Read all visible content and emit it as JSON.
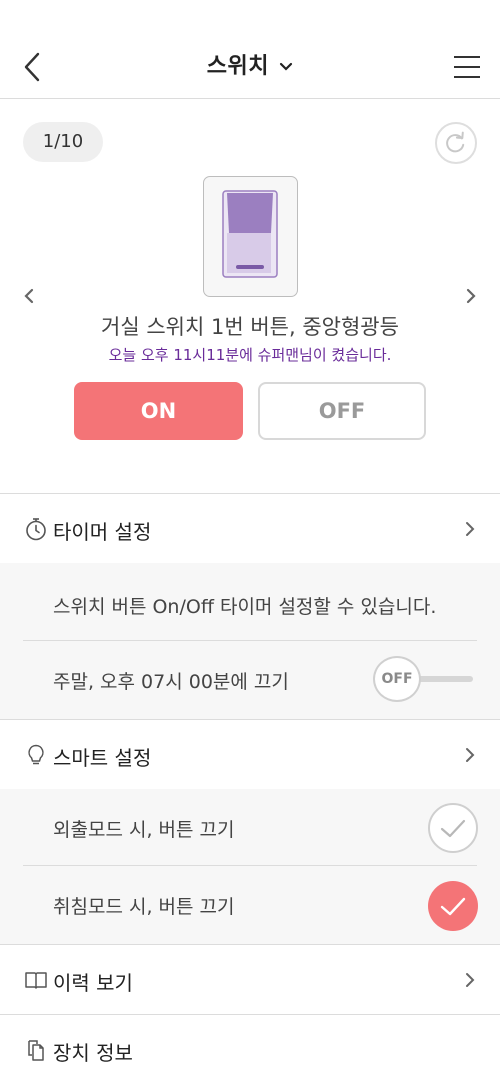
{
  "header": {
    "title": "스위치",
    "back_icon": "back-arrow-icon",
    "menu_icon": "hamburger-menu-icon",
    "dropdown_icon": "chevron-down-icon"
  },
  "device": {
    "pager": "1/10",
    "name": "거실 스위치 1번 버튼, 중앙형광등",
    "status_message": "오늘 오후 11시11분에 슈퍼맨님이 켰습니다.",
    "on_label": "ON",
    "off_label": "OFF",
    "state": "ON"
  },
  "timer": {
    "title": "타이머 설정",
    "description": "스위치 버튼 On/Off 타이머 설정할 수 있습니다.",
    "item_label": "주말, 오후 07시 00분에 끄기",
    "toggle_label": "OFF"
  },
  "smart": {
    "title": "스마트 설정",
    "items": [
      {
        "label": "외출모드 시, 버튼 끄기",
        "checked": false
      },
      {
        "label": "취침모드 시, 버튼 끄기",
        "checked": true
      }
    ]
  },
  "history": {
    "title": "이력 보기"
  },
  "device_info": {
    "title": "장치 정보"
  },
  "colors": {
    "accent": "#f47477",
    "status_text": "#6a2c9a",
    "switch_purple": "#9b7fc0"
  }
}
